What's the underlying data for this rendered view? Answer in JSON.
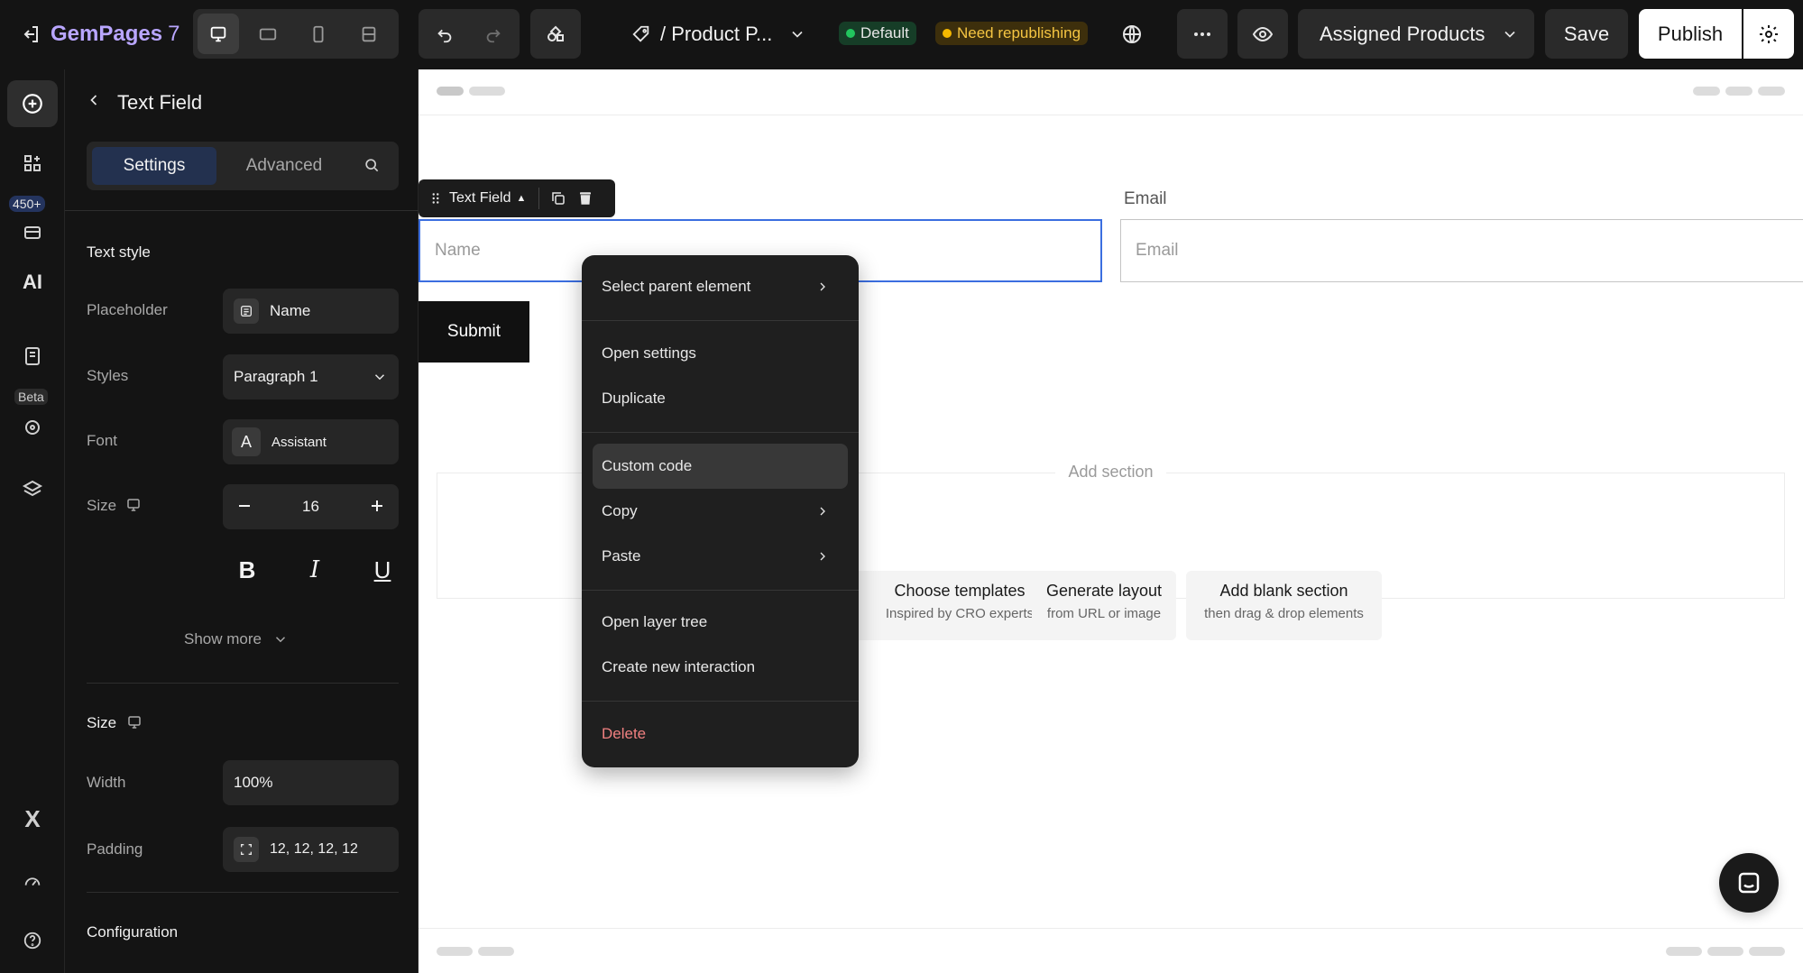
{
  "app": {
    "brand_name": "GemPages",
    "brand_version": "7",
    "page_name": "/ Product P...",
    "default_badge": "Default",
    "republish_badge": "Need republishing",
    "assigned_products_label": "Assigned Products",
    "save_label": "Save",
    "publish_label": "Publish"
  },
  "rail": {
    "count_badge": "450+",
    "beta_badge": "Beta"
  },
  "panel": {
    "title": "Text Field",
    "tab_settings": "Settings",
    "tab_advanced": "Advanced",
    "text_style_heading": "Text style",
    "placeholder_label": "Placeholder",
    "placeholder_value": "Name",
    "styles_label": "Styles",
    "styles_value": "Paragraph 1",
    "font_label": "Font",
    "font_value": "Assistant",
    "size_label": "Size",
    "size_value": "16",
    "show_more": "Show more",
    "size_heading": "Size",
    "width_label": "Width",
    "width_value": "100%",
    "padding_label": "Padding",
    "padding_value": "12, 12, 12, 12",
    "configuration_heading": "Configuration"
  },
  "canvas": {
    "toolbar_label": "Text Field",
    "name_placeholder": "Name",
    "email_label": "Email",
    "email_placeholder": "Email",
    "submit_label": "Submit",
    "add_section": "Add section",
    "cards": [
      {
        "title": "Choose templates",
        "subtitle": "Inspired by CRO experts"
      },
      {
        "title": "Generate layout",
        "subtitle": "from URL or image"
      },
      {
        "title": "Add blank section",
        "subtitle": "then drag & drop elements"
      }
    ]
  },
  "context_menu": {
    "items": [
      {
        "label": "Select parent element"
      },
      {
        "label": "Open settings"
      },
      {
        "label": "Duplicate"
      },
      {
        "label": "Custom code"
      },
      {
        "label": "Copy"
      },
      {
        "label": "Paste"
      },
      {
        "label": "Open layer tree"
      },
      {
        "label": "Create new interaction"
      },
      {
        "label": "Delete"
      }
    ]
  },
  "colors": {
    "dark_bg": "#141414",
    "accent_blue": "#3b6ee0",
    "default_green": "#22c55e",
    "republish_orange": "#f5b800",
    "delete_red": "#f08080"
  }
}
